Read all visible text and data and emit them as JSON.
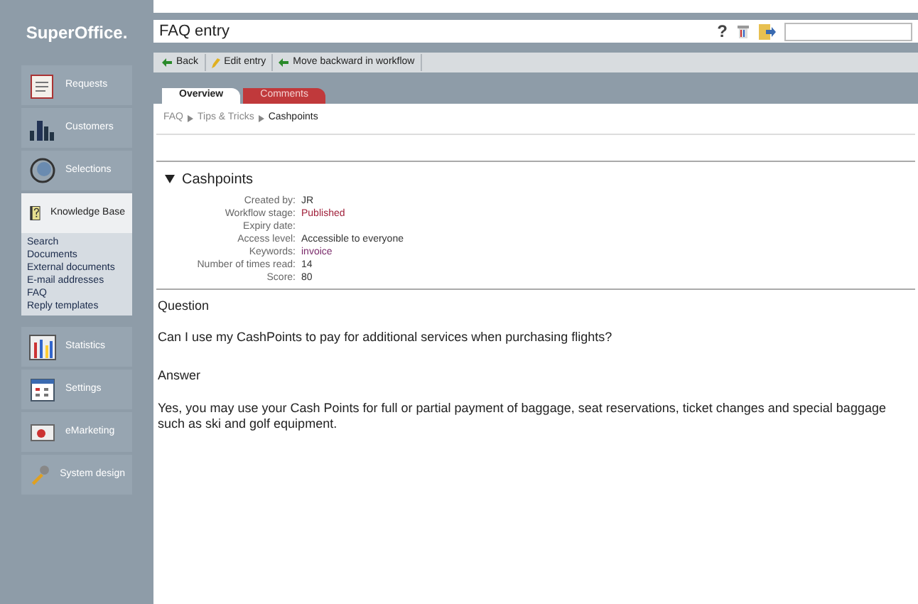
{
  "sidebar": {
    "logo": "SuperOffice.",
    "items": [
      {
        "label": "Requests",
        "kind": "requests",
        "selected": false
      },
      {
        "label": "Customers",
        "kind": "customers",
        "selected": false
      },
      {
        "label": "Selections",
        "kind": "selections",
        "selected": false
      },
      {
        "label": "Knowledge Base",
        "kind": "knowledge",
        "selected": true,
        "children": [
          "Search",
          "Documents",
          "External documents",
          "E-mail addresses",
          "FAQ",
          "Reply templates"
        ]
      },
      {
        "label": "Statistics",
        "kind": "statistics",
        "selected": false
      },
      {
        "label": "Settings",
        "kind": "settings",
        "selected": false
      },
      {
        "label": "eMarketing",
        "kind": "emarketing",
        "selected": false
      },
      {
        "label": "System design",
        "kind": "systemdesign",
        "selected": false
      }
    ]
  },
  "header": {
    "title": "FAQ entry",
    "help": "?"
  },
  "toolbar": [
    {
      "label": "Back",
      "kind": "arrow"
    },
    {
      "label": "Edit entry",
      "kind": "pencil"
    },
    {
      "label": "Move backward in workflow",
      "kind": "arrow"
    }
  ],
  "tabs": [
    {
      "label": "Overview",
      "selected": true
    },
    {
      "label": "Comments",
      "selected": false
    }
  ],
  "breadcrumb": [
    "FAQ",
    "Tips & Tricks",
    "Cashpoints"
  ],
  "section": {
    "title": "Cashpoints",
    "expanded": true,
    "fields": [
      {
        "label": "Created by:",
        "value": "JR",
        "color": "#333333"
      },
      {
        "label": "Workflow stage:",
        "value": "Published",
        "color": "#a0203a"
      },
      {
        "label": "Expiry date:"
      },
      {
        "label": "Access level:",
        "value": "Accessible to everyone",
        "color": "#333333"
      },
      {
        "label": "Keywords:",
        "value": "invoice",
        "color": "#7a2a6a"
      },
      {
        "label": "Number of times read:",
        "value": "14",
        "color": "#333333"
      },
      {
        "label": "Score:",
        "value": "80",
        "color": "#333333"
      }
    ]
  },
  "question": {
    "heading": "Question",
    "text": "Can I use my CashPoints to pay for additional services when purchasing flights?"
  },
  "answer": {
    "heading": "Answer",
    "text": "Yes, you may use your Cash Points for full or partial payment of baggage, seat reservations, ticket changes and special baggage such as ski and golf equipment."
  }
}
